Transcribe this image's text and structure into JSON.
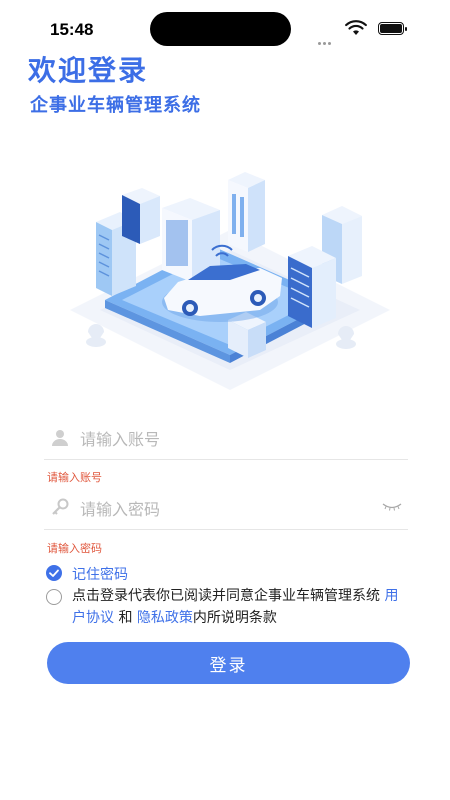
{
  "status_bar": {
    "time": "15:48"
  },
  "header": {
    "title": "欢迎登录",
    "subtitle": "企事业车辆管理系统"
  },
  "form": {
    "account": {
      "placeholder": "请输入账号",
      "value": "",
      "error": "请输入账号"
    },
    "password": {
      "placeholder": "请输入密码",
      "value": "",
      "error": "请输入密码"
    },
    "remember": {
      "label": "记住密码",
      "checked": true
    },
    "agreement": {
      "checked": false,
      "text_1": "点击登录代表你已阅读并同意企事业车辆管理系统 ",
      "link_user": "用户协议",
      "text_2": " 和 ",
      "link_privacy": "隐私政策",
      "text_3": "内所说明条款"
    },
    "login_label": "登录"
  },
  "colors": {
    "accent": "#3f71e8",
    "error": "#e0573d",
    "button": "#4f80ee"
  },
  "icons": [
    "user-icon",
    "key-icon",
    "eye-closed-icon",
    "check-icon",
    "wifi-icon",
    "battery-icon"
  ]
}
